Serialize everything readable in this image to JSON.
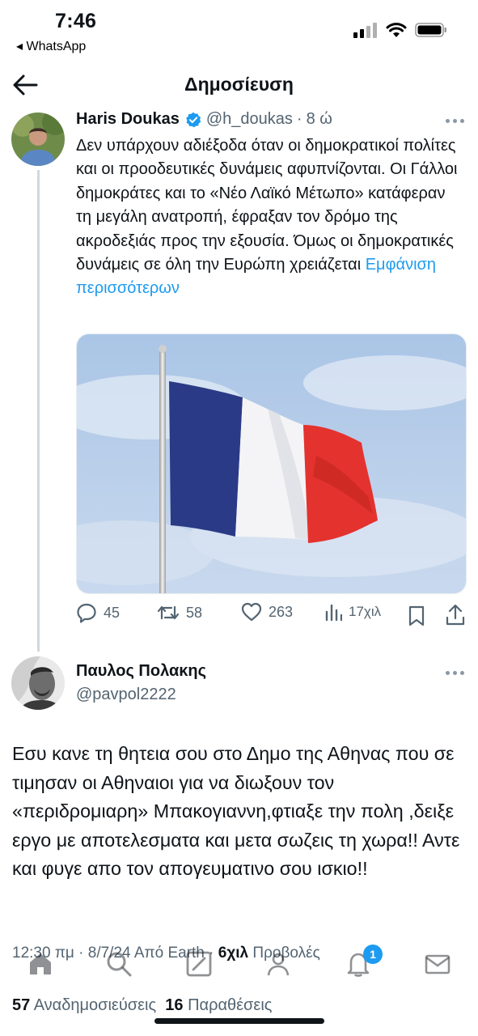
{
  "status_bar": {
    "time": "7:46",
    "back_app": "◂ WhatsApp"
  },
  "header": {
    "title": "Δημοσίευση"
  },
  "tweet": {
    "author_name": "Haris Doukas",
    "handle": "@h_doukas",
    "separator": "·",
    "age": "8 ώ",
    "text": "Δεν υπάρχουν αδιέξοδα όταν οι δημοκρατικοί πολίτες και οι προοδευτικές δυνάμεις αφυπνίζονται. Οι Γάλλοι δημοκράτες και το «Νέο Λαϊκό Μέτωπο» κατάφεραν τη μεγάλη ανατροπή, έφραξαν τον δρόμο της ακροδεξιάς προς την εξουσία. Όμως οι δημοκρατικές δυνάμεις σε όλη την Ευρώπη χρειάζεται",
    "show_more": "Εμφάνιση περισσότερων",
    "actions": {
      "replies": "45",
      "retweets": "58",
      "likes": "263",
      "views": "17χιλ"
    }
  },
  "reply": {
    "author_name": "Παυλος Πολακης",
    "handle": "@pavpol2222",
    "text": "Εσυ κανε τη θητεια σου στο Δημο της Αθηνας που σε τιμησαν οι Αθηναιοι για να διωξουν τον «περιδρομιαρη» Μπακογιαννη,φτιαξε την πολη ,δειξε εργο με αποτελεσματα και μετα σωζεις τη χωρα!! Αντε και φυγε απο τον απογευματινο σου ισκιο!!",
    "meta_time": "12:30 πμ · 8/7/24 Από Earth · ",
    "meta_views_count": "6χιλ",
    "meta_views_label": " Προβολές",
    "reposts_count": "57",
    "reposts_label": " Αναδημοσιεύσεις",
    "quotes_count": "16",
    "quotes_label": " Παραθέσεις"
  },
  "tabbar": {
    "notification_count": "1",
    "icons": [
      "home-icon",
      "search-icon",
      "compose-icon",
      "communities-icon",
      "bell-icon",
      "mail-icon"
    ]
  },
  "colors": {
    "accent": "#1d9bf0",
    "secondary_text": "#536471",
    "flag_blue": "#2b3a86",
    "flag_white": "#f4f4f6",
    "flag_red": "#e4322f"
  }
}
